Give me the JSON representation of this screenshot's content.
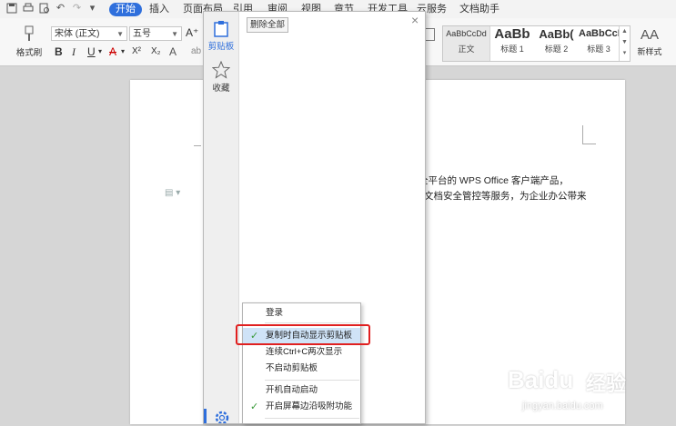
{
  "menu_tabs": [
    "开始",
    "插入",
    "页面布局",
    "引用",
    "审阅",
    "视图",
    "章节",
    "开发工具",
    "云服务",
    "文档助手"
  ],
  "ribbon": {
    "format_painter": "格式刷",
    "font_name": "宋体 (正文)",
    "font_size": "五号",
    "grow_font": "A⁺",
    "bold": "B",
    "italic": "I",
    "underline": "U",
    "font_color": "A",
    "superscript": "X²",
    "subscript": "X₂",
    "clear_format": "A",
    "styles": [
      {
        "sample": "AaBbCcDd",
        "name": "正文"
      },
      {
        "sample": "AaBb",
        "name": "标题 1"
      },
      {
        "sample": "AaBb(",
        "name": "标题 2"
      },
      {
        "sample": "AaBbCcI",
        "name": "标题 3"
      }
    ],
    "new_style_icon": "AA",
    "new_style": "新样式"
  },
  "document": {
    "line1": "全平台的 WPS Office 客户端产品，",
    "line2": "文档安全管控等服务，为企业办公带来"
  },
  "clipboard": {
    "clipboard_label": "剪贴板",
    "favorites_label": "收藏",
    "delete_all": "删除全部",
    "close": "×"
  },
  "context_menu": {
    "items": [
      {
        "label": "登录",
        "checked": false
      },
      {
        "label": "复制时自动显示剪贴板",
        "checked": true
      },
      {
        "label": "连续Ctrl+C两次显示",
        "checked": false
      },
      {
        "label": "不启动剪贴板",
        "checked": false
      },
      {
        "label": "开机自动启动",
        "checked": false
      },
      {
        "label": "开启屏幕边沿吸附功能",
        "checked": true
      }
    ],
    "check_glyph": "✓"
  },
  "watermark": {
    "brand": "Baidu",
    "suffix": "经验",
    "url": "jingyan.baidu.com"
  },
  "colors": {
    "accent": "#2f6fdc",
    "highlight_border": "#e02020",
    "selected_row": "#cfe3f7",
    "check": "#3a9a3a"
  }
}
